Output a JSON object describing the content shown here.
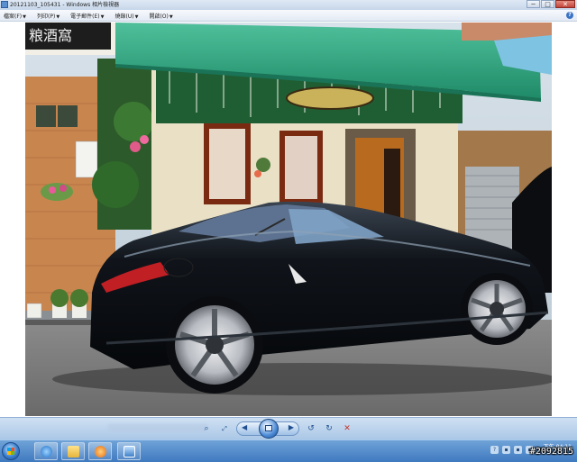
{
  "window": {
    "title": "20121103_105431 - Windows 相片檢視器",
    "minimize_label": "─",
    "maximize_label": "□",
    "close_label": "✕"
  },
  "menu": {
    "items": [
      {
        "label": "檔案(F)"
      },
      {
        "label": "列印(P)"
      },
      {
        "label": "電子郵件(E)"
      },
      {
        "label": "燒錄(U)"
      },
      {
        "label": "開啟(O)"
      }
    ],
    "help_label": "?"
  },
  "photo": {
    "sign_text": "粮酒窩",
    "colors": {
      "awning": "#2f9f7c",
      "car": "#0d1014",
      "wall": "#efe6cf"
    }
  },
  "controls": {
    "zoom_icon": "magnifier-icon",
    "fit_icon": "fit-window-icon",
    "prev_icon": "previous-icon",
    "slideshow_icon": "slideshow-icon",
    "next_icon": "next-icon",
    "rotate_ccw_icon": "rotate-left-icon",
    "rotate_cw_icon": "rotate-right-icon",
    "delete_icon": "delete-icon"
  },
  "taskbar": {
    "apps": [
      {
        "name": "internet-explorer-icon"
      },
      {
        "name": "windows-explorer-icon"
      },
      {
        "name": "media-player-icon"
      },
      {
        "name": "photo-viewer-icon"
      }
    ],
    "clock_time": "下午 04:11"
  },
  "watermark": "#2092815"
}
